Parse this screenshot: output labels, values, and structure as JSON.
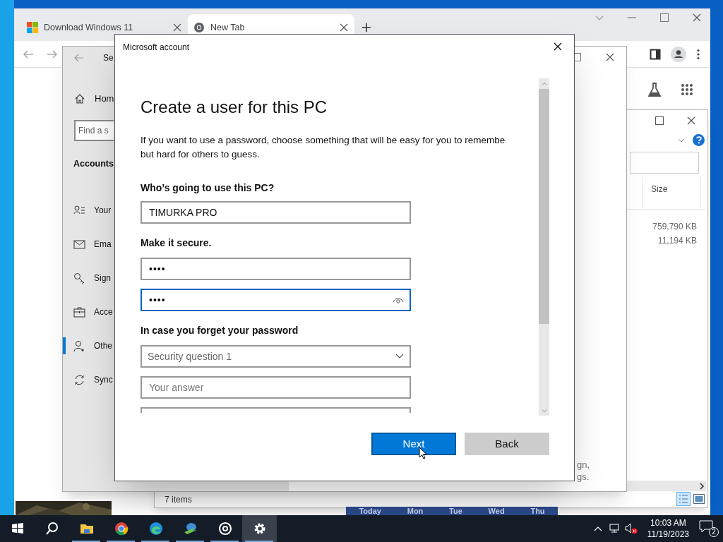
{
  "browser": {
    "tabs": [
      {
        "label": "Download Windows 11",
        "selected": false
      },
      {
        "label": "New Tab",
        "selected": true
      }
    ]
  },
  "settings": {
    "title": "Se",
    "home": "Hom",
    "search_placeholder": "Find a s",
    "section": "Accounts",
    "items": [
      {
        "label": "Your",
        "selected": false
      },
      {
        "label": "Ema",
        "selected": false
      },
      {
        "label": "Sign",
        "selected": false
      },
      {
        "label": "Acce",
        "selected": false
      },
      {
        "label": "Othe",
        "selected": true
      },
      {
        "label": "Sync",
        "selected": false
      }
    ],
    "fragments": [
      "gn,",
      "gs."
    ]
  },
  "explorer": {
    "columns": [
      "Size"
    ],
    "sizes": [
      "759,790 KB",
      "11,194 KB"
    ],
    "status": "7 items"
  },
  "weather": {
    "days": [
      "Today",
      "Mon",
      "Tue",
      "Wed",
      "Thu"
    ]
  },
  "dialog": {
    "title": "Microsoft account",
    "heading": "Create a user for this PC",
    "description_lines": [
      "If you want to use a password, choose something that will be easy for you to remembe",
      "but hard for others to guess."
    ],
    "name_label": "Who’s going to use this PC?",
    "name_value": "TIMURKA PRO",
    "secure_label": "Make it secure.",
    "passwords": [
      {
        "value": "••••",
        "focused": false
      },
      {
        "value": "••••",
        "focused": true
      }
    ],
    "recovery_label": "In case you forget your password",
    "question_placeholder": "Security question 1",
    "answer_placeholder": "Your answer",
    "buttons": [
      {
        "label": "Next",
        "kind": "primary"
      },
      {
        "label": "Back",
        "kind": "secondary"
      }
    ]
  },
  "taskbar": {
    "time": "10:03 AM",
    "date": "11/19/2023",
    "notifications": "2"
  }
}
